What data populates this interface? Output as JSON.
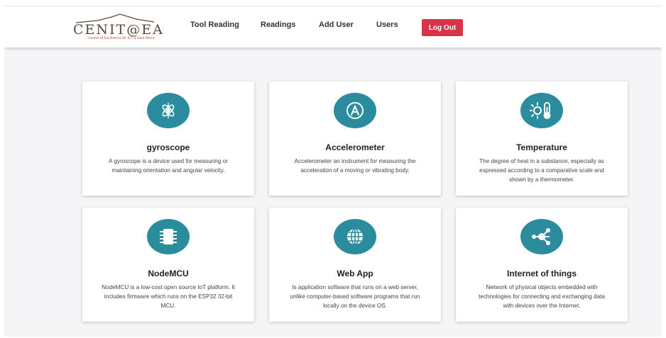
{
  "nav": {
    "logo": {
      "brand": "CENIT@EA",
      "tagline": "Centre of Excellence for ICT in East Africa"
    },
    "links": [
      "Tool Reading",
      "Readings",
      "Add User",
      "Users"
    ],
    "logout_label": "Log Out"
  },
  "cards": [
    {
      "icon": "gyroscope-icon",
      "title": "gyroscope",
      "description": "A gyroscope is a device used for measuring or maintaining orientation and angular velocity."
    },
    {
      "icon": "accelerometer-icon",
      "title": "Accelerometer",
      "description": "Accelerometer an instrument for measuring the acceleration of a moving or vibrating body."
    },
    {
      "icon": "temperature-icon",
      "title": "Temperature",
      "description": "The degree of heat in a substance, especially as expressed according to a comparative scale and shown by a thermometer."
    },
    {
      "icon": "microchip-icon",
      "title": "NodeMCU",
      "description": "NodeMCU is a low-cost open source IoT platform. It includes firmware which runs on the ESP32 32-bit MCU."
    },
    {
      "icon": "globe-icon",
      "title": "Web App",
      "description": "Is application software that runs on a web server, unlike computer-based software programs that run locally on the device OS."
    },
    {
      "icon": "network-icon",
      "title": "Internet of things",
      "description": "Network of physical objects embedded with technologies for connecting and exchanging data with devices over the Internet."
    }
  ],
  "colors": {
    "accent": "#2a8c9c",
    "logout": "#d9334a"
  }
}
